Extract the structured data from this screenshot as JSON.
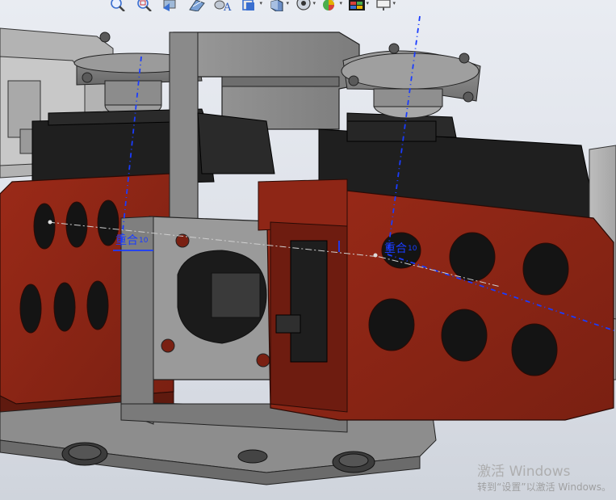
{
  "app": {
    "window": "SolidWorks 3D assembly viewport"
  },
  "toolbar": {
    "buttons": [
      {
        "id": "zoom-to-fit",
        "icon": "zoom-to-fit-icon"
      },
      {
        "id": "zoom-to-area",
        "icon": "zoom-to-area-icon"
      },
      {
        "id": "previous-view",
        "icon": "previous-view-icon"
      },
      {
        "id": "section-view",
        "icon": "section-view-icon"
      },
      {
        "id": "dynamic-annotation",
        "icon": "annotation-view-icon"
      },
      {
        "id": "view-orientation",
        "icon": "view-orientation-icon"
      },
      {
        "id": "display-style",
        "icon": "display-style-icon"
      },
      {
        "id": "hide-show-items",
        "icon": "hide-show-icon"
      },
      {
        "id": "edit-appearance",
        "icon": "appearance-icon"
      },
      {
        "id": "apply-scene",
        "icon": "scene-icon"
      },
      {
        "id": "view-settings",
        "icon": "monitor-icon"
      }
    ]
  },
  "annotations": {
    "left": {
      "text": "重合",
      "sub": "10"
    },
    "right": {
      "text": "重合",
      "sub": "10"
    }
  },
  "watermark": {
    "title": "激活 Windows",
    "subtitle": "转到“设置”以激活 Windows。"
  },
  "colors": {
    "background": "#dfe3ea",
    "part_red": "#8b2516",
    "part_gray": "#8a8a8a",
    "servo_black": "#1e1e1e",
    "dimension_blue": "#1a3cff"
  }
}
